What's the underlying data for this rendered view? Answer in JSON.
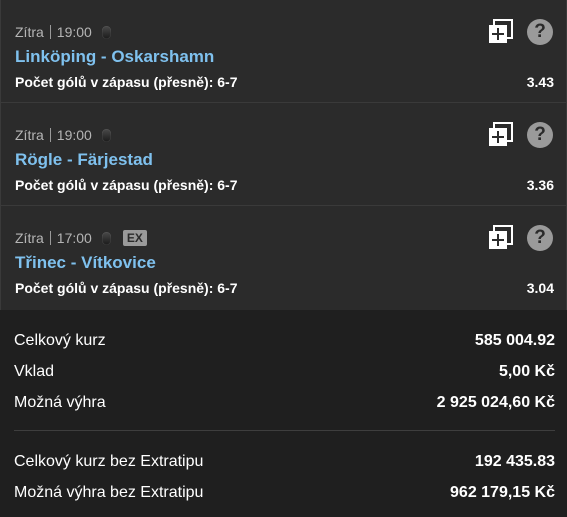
{
  "bets": [
    {
      "day": "Zítra",
      "time": "19:00",
      "badge": "",
      "match": "Linköping - Oskarshamn",
      "market": "Počet gólů v zápasu (přesně): 6-7",
      "odds": "3.43",
      "help": "?"
    },
    {
      "day": "Zítra",
      "time": "19:00",
      "badge": "",
      "match": "Rögle - Färjestad",
      "market": "Počet gólů v zápasu (přesně): 6-7",
      "odds": "3.36",
      "help": "?"
    },
    {
      "day": "Zítra",
      "time": "17:00",
      "badge": "EX",
      "match": "Třinec - Vítkovice",
      "market": "Počet gólů v zápasu (přesně): 6-7",
      "odds": "3.04",
      "help": "?"
    }
  ],
  "summary": {
    "total_odds_label": "Celkový kurz",
    "total_odds_value": "585 004.92",
    "stake_label": "Vklad",
    "stake_value": "5,00 Kč",
    "win_label": "Možná výhra",
    "win_value": "2 925 024,60 Kč",
    "total_odds_noex_label": "Celkový kurz bez Extratipu",
    "total_odds_noex_value": "192 435.83",
    "win_noex_label": "Možná výhra bez Extratipu",
    "win_noex_value": "962 179,15 Kč"
  }
}
